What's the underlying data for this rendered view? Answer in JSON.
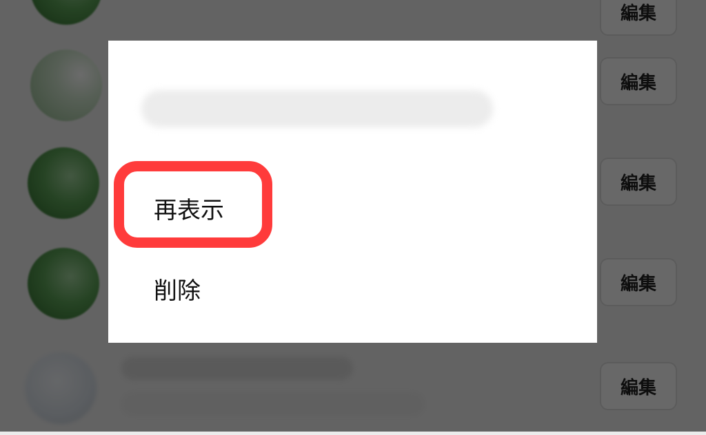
{
  "list": {
    "edit_label": "編集"
  },
  "dialog": {
    "items": [
      {
        "label": "再表示"
      },
      {
        "label": "削除"
      }
    ]
  },
  "colors": {
    "highlight": "#ff3b3b",
    "overlay": "rgba(0,0,0,0.58)",
    "dialog_bg": "#ffffff"
  }
}
